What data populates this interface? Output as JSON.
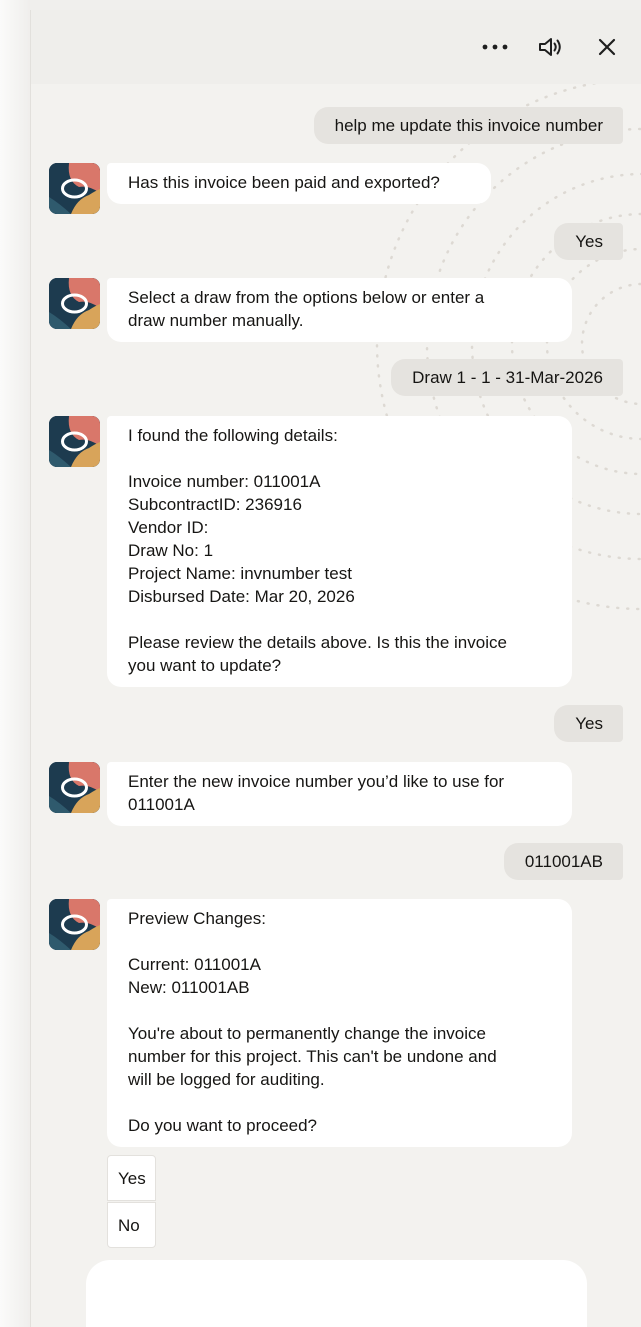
{
  "header": {
    "more_icon": "more-horizontal-icon",
    "speaker_icon": "speaker-icon",
    "close_icon": "close-icon"
  },
  "messages": [
    {
      "role": "user",
      "text": "help me update this invoice number"
    },
    {
      "role": "bot",
      "lines": [
        "Has this invoice been paid and exported?"
      ]
    },
    {
      "role": "user",
      "text": "Yes"
    },
    {
      "role": "bot",
      "lines": [
        "Select a draw from the options below or enter a",
        "draw number manually."
      ]
    },
    {
      "role": "user",
      "text": "Draw 1 - 1 - 31-Mar-2026"
    },
    {
      "role": "bot",
      "lines": [
        "I found the following details:",
        "",
        "Invoice number: 011001A",
        "SubcontractID: 236916",
        "Vendor ID:",
        "Draw No: 1",
        "Project Name: invnumber test",
        "Disbursed Date: Mar 20, 2026",
        "",
        "Please review the details above. Is this the invoice",
        "you want to update?"
      ]
    },
    {
      "role": "user",
      "text": "Yes"
    },
    {
      "role": "bot",
      "lines": [
        "Enter the new invoice number you’d like to use for",
        "011001A"
      ]
    },
    {
      "role": "user",
      "text": "011001AB"
    },
    {
      "role": "bot",
      "lines": [
        "Preview Changes:",
        "",
        "Current: 011001A",
        "New: 011001AB",
        "",
        "You're about to permanently change the invoice",
        "number for this project. This can't be undone and",
        "will be logged for auditing.",
        "",
        "Do you want to proceed?"
      ]
    }
  ],
  "actions": {
    "yes_label": "Yes",
    "no_label": "No"
  },
  "colors": {
    "user_bubble": "#e5e3df",
    "bot_bubble": "#ffffff",
    "panel_bg": "#f3f2ef"
  }
}
